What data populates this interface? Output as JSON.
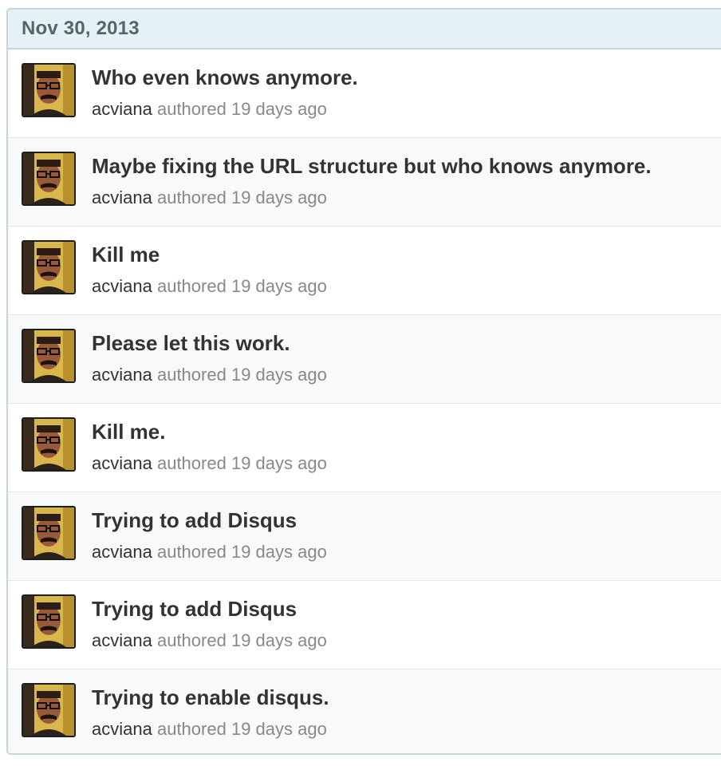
{
  "date_header": "Nov 30, 2013",
  "commits": [
    {
      "title": "Who even knows anymore.",
      "author": "acviana",
      "verb": "authored",
      "time": "19 days ago"
    },
    {
      "title": "Maybe fixing the URL structure but who knows anymore.",
      "author": "acviana",
      "verb": "authored",
      "time": "19 days ago"
    },
    {
      "title": "Kill me",
      "author": "acviana",
      "verb": "authored",
      "time": "19 days ago"
    },
    {
      "title": "Please let this work.",
      "author": "acviana",
      "verb": "authored",
      "time": "19 days ago"
    },
    {
      "title": "Kill me.",
      "author": "acviana",
      "verb": "authored",
      "time": "19 days ago"
    },
    {
      "title": "Trying to add Disqus",
      "author": "acviana",
      "verb": "authored",
      "time": "19 days ago"
    },
    {
      "title": "Trying to add Disqus",
      "author": "acviana",
      "verb": "authored",
      "time": "19 days ago"
    },
    {
      "title": "Trying to enable disqus.",
      "author": "acviana",
      "verb": "authored",
      "time": "19 days ago"
    }
  ],
  "colors": {
    "header_bg": "#e6f1f6",
    "border": "#c5d5dd",
    "title_text": "#333333",
    "meta_text": "#888888",
    "alt_row_bg": "#f7f9fa"
  }
}
